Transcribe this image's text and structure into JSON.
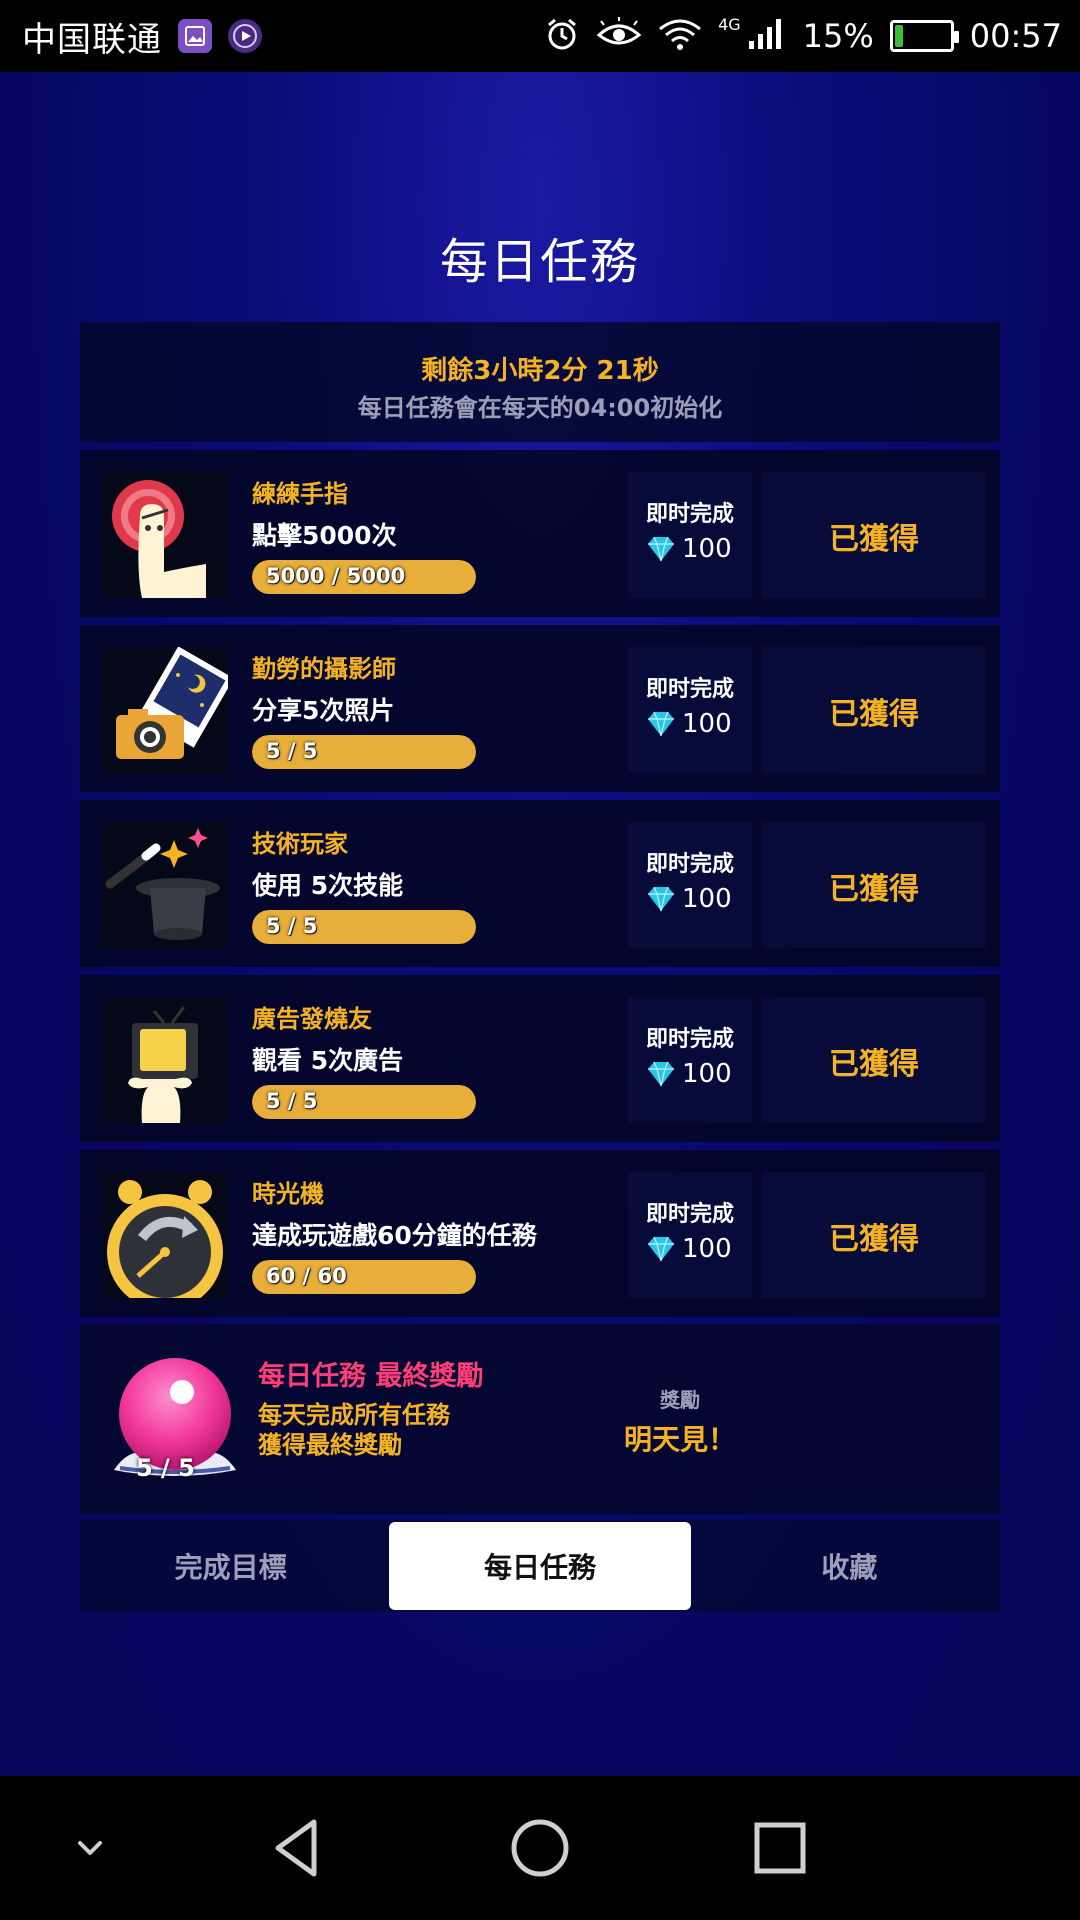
{
  "status_bar": {
    "carrier": "中国联通",
    "network": "4G",
    "battery_percent": "15%",
    "time": "00:57",
    "battery_level": 0.15
  },
  "page": {
    "title": "每日任務"
  },
  "timer": {
    "remaining": "剩餘3小時2分 21秒",
    "note": "每日任務會在每天的04:00初始化"
  },
  "tasks": [
    {
      "icon": "finger-tap-icon",
      "name": "練練手指",
      "desc": "點擊5000次",
      "progress_text": "5000 / 5000",
      "progress": 1.0,
      "reward_label": "即时完成",
      "reward_value": "100",
      "status": "已獲得"
    },
    {
      "icon": "camera-photo-icon",
      "name": "勤勞的攝影師",
      "desc": "分享5次照片",
      "progress_text": "5 / 5",
      "progress": 1.0,
      "reward_label": "即时完成",
      "reward_value": "100",
      "status": "已獲得"
    },
    {
      "icon": "magic-hat-icon",
      "name": "技術玩家",
      "desc": "使用 5次技能",
      "progress_text": "5 / 5",
      "progress": 1.0,
      "reward_label": "即时完成",
      "reward_value": "100",
      "status": "已獲得"
    },
    {
      "icon": "tv-ad-icon",
      "name": "廣告發燒友",
      "desc": "觀看 5次廣告",
      "progress_text": "5 / 5",
      "progress": 1.0,
      "reward_label": "即时完成",
      "reward_value": "100",
      "status": "已獲得"
    },
    {
      "icon": "time-machine-icon",
      "name": "時光機",
      "desc": "達成玩遊戲60分鐘的任務",
      "progress_text": "60 / 60",
      "progress": 1.0,
      "reward_label": "即时完成",
      "reward_value": "100",
      "status": "已獲得"
    }
  ],
  "final_reward": {
    "title": "每日任務 最終獎勵",
    "desc_line1": "每天完成所有任務",
    "desc_line2": "獲得最終獎勵",
    "count": "5 / 5",
    "reward_label": "獎勵",
    "reward_value": "明天見！"
  },
  "tabs": [
    {
      "label": "完成目標",
      "active": false
    },
    {
      "label": "每日任務",
      "active": true
    },
    {
      "label": "收藏",
      "active": false
    }
  ],
  "colors": {
    "accent_gold": "#f5b324",
    "accent_pink": "#ff3d76",
    "diamond": "#29c6e8",
    "background": "#0b0b7a"
  }
}
